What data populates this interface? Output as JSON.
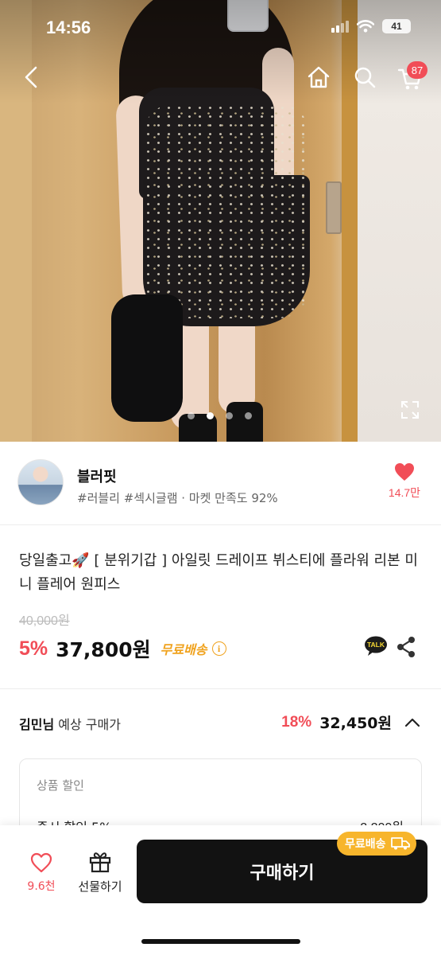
{
  "status_bar": {
    "time": "14:56",
    "battery": "41"
  },
  "top_nav": {
    "cart_badge": "87"
  },
  "gallery": {
    "total": 4,
    "active_index": 1
  },
  "shop": {
    "name": "블러핏",
    "meta": "#러블리 #섹시글램 · 마켓 만족도 92%",
    "likes": "14.7만"
  },
  "product": {
    "title": "당일출고🚀 [ 분위기갑 ] 아일릿 드레이프 뷔스티에 플라워 리본 미니 플레어 원피스",
    "original_price": "40,000원",
    "discount_rate": "5%",
    "price": "37,800원",
    "free_shipping": "무료배송",
    "talk_label": "TALK"
  },
  "member_price": {
    "user_name": "김민님",
    "label": "예상 구매가",
    "discount_rate": "18%",
    "price": "32,450원"
  },
  "discount_box": {
    "heading": "상품 할인",
    "row_label": "즉시 할인 5%",
    "row_value": "-2,200원"
  },
  "bottom_bar": {
    "wish_count": "9.6천",
    "gift_label": "선물하기",
    "buy_label": "구매하기",
    "ship_bubble": "무료배송"
  },
  "colors": {
    "accent": "#f14d57",
    "shipping": "#f0a31f",
    "buy_button": "#121212"
  }
}
